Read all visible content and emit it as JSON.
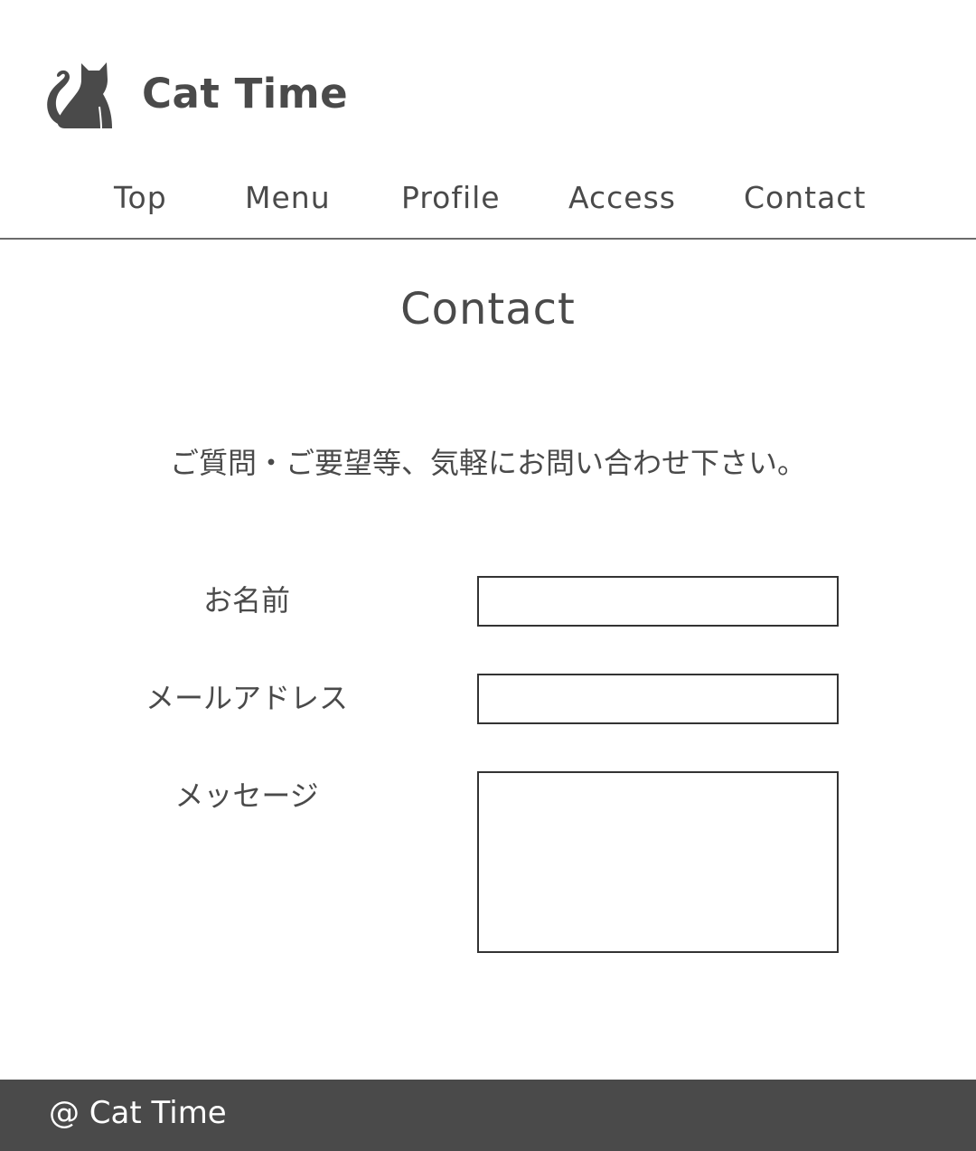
{
  "header": {
    "logo_icon": "cat-icon",
    "site_title": "Cat Time"
  },
  "nav": {
    "items": [
      {
        "label": "Top"
      },
      {
        "label": "Menu"
      },
      {
        "label": "Profile"
      },
      {
        "label": "Access"
      },
      {
        "label": "Contact"
      }
    ]
  },
  "main": {
    "title": "Contact",
    "intro": "ご質問・ご要望等、気軽にお問い合わせ下さい。",
    "form": {
      "name_label": "お名前",
      "name_value": "",
      "email_label": "メールアドレス",
      "email_value": "",
      "message_label": "メッセージ",
      "message_value": ""
    }
  },
  "footer": {
    "copyright": "@ Cat Time"
  },
  "colors": {
    "text": "#4a4a4a",
    "footer_bg": "#4a4a4a",
    "footer_text": "#ffffff",
    "border": "#333333"
  }
}
